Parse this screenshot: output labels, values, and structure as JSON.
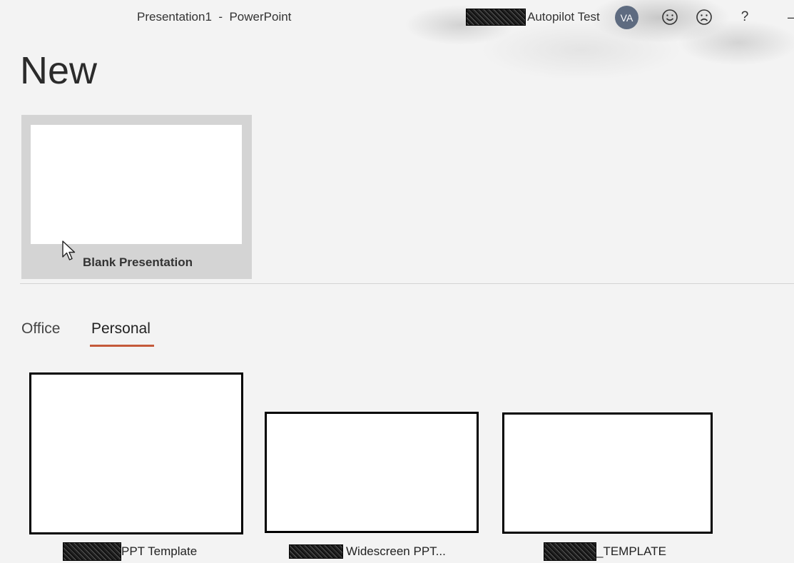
{
  "window": {
    "title": "Presentation1  -  PowerPoint"
  },
  "account": {
    "name": "Autopilot Test",
    "initials": "VA"
  },
  "toolbar": {
    "help_label": "?"
  },
  "page": {
    "title": "New"
  },
  "blank": {
    "label": "Blank Presentation"
  },
  "tabs": [
    {
      "label": "Office",
      "selected": false
    },
    {
      "label": "Personal",
      "selected": true
    }
  ],
  "templates": [
    {
      "label": "PPT Template"
    },
    {
      "label": "Widescreen PPT..."
    },
    {
      "label": "_TEMPLATE"
    }
  ],
  "colors": {
    "accent": "#c55a3a",
    "avatar": "#5e6b80"
  },
  "icons": [
    "smile-icon",
    "frown-icon",
    "help-icon",
    "minimize-icon",
    "mouse-cursor-icon"
  ]
}
